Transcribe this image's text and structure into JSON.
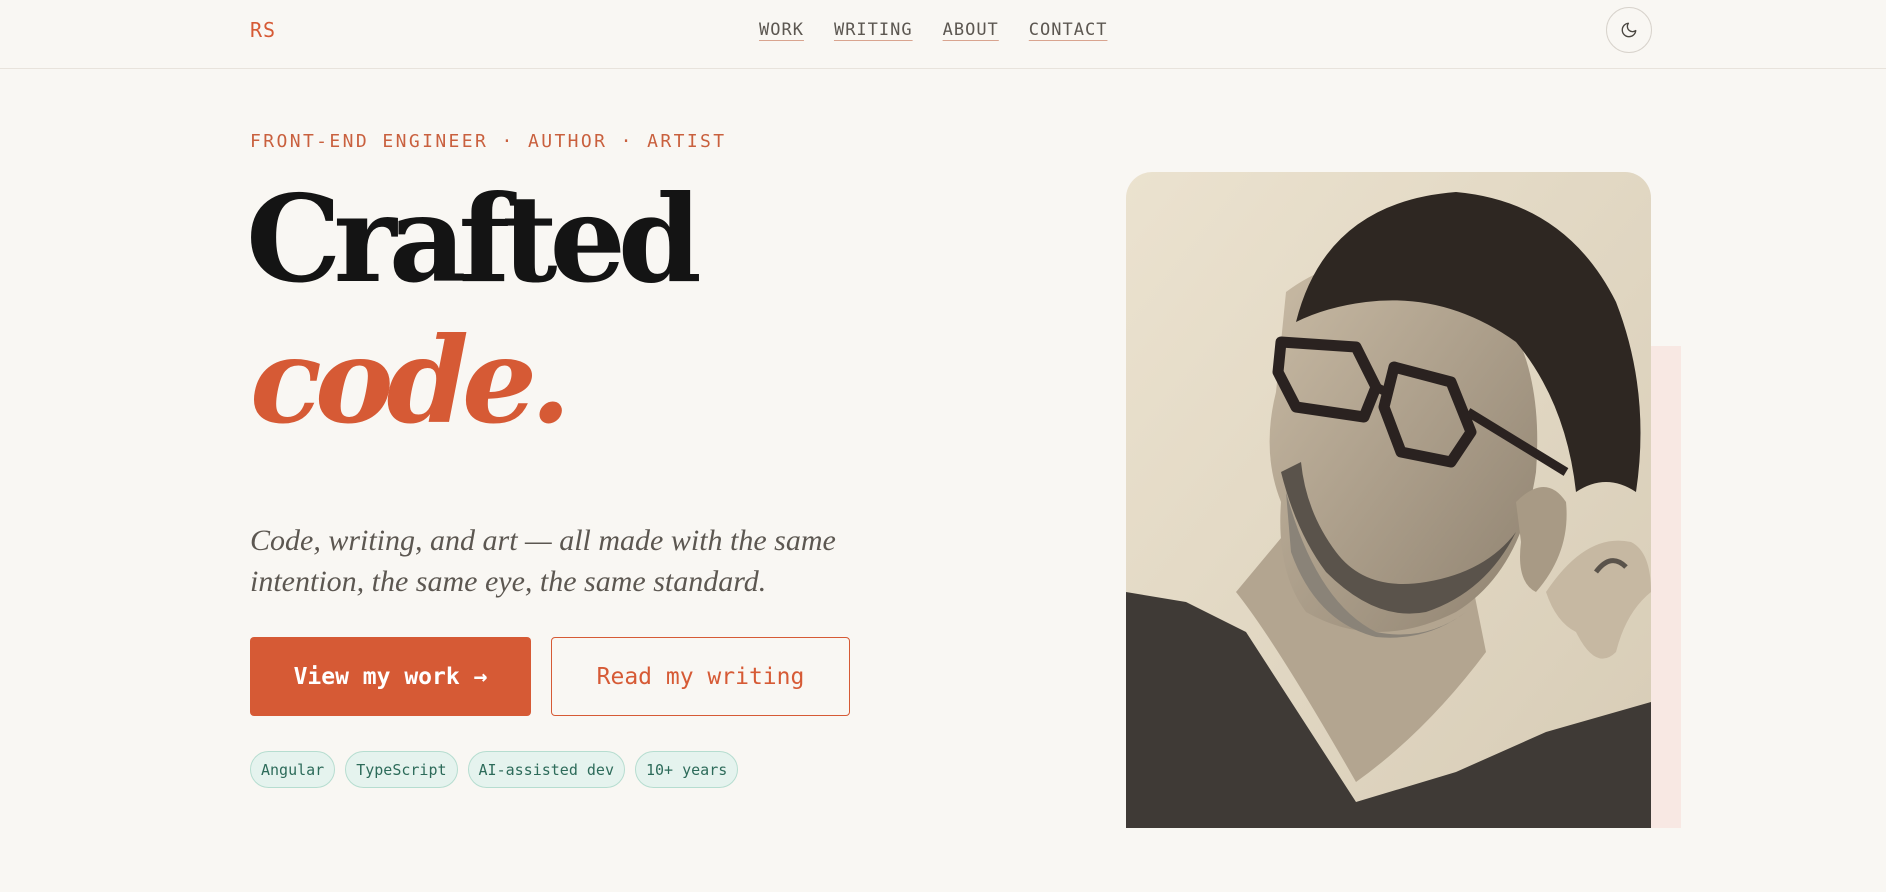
{
  "header": {
    "logo": "RS",
    "nav": [
      "WORK",
      "WRITING",
      "ABOUT",
      "CONTACT"
    ],
    "theme_toggle_icon": "moon-icon"
  },
  "hero": {
    "eyebrow": "FRONT-END ENGINEER · AUTHOR · ARTIST",
    "headline_line1": "Crafted",
    "headline_line2": "code.",
    "tagline": "Code, writing, and art — all made with the same intention, the same eye, the same standard.",
    "primary_cta": "View my work →",
    "secondary_cta": "Read my writing",
    "tags": [
      "Angular",
      "TypeScript",
      "AI-assisted dev",
      "10+ years"
    ]
  },
  "colors": {
    "accent": "#d65a35",
    "background": "#f9f7f3",
    "heading": "#141414",
    "tag_bg": "#e5f3ee",
    "tag_text": "#2d6b5a"
  }
}
